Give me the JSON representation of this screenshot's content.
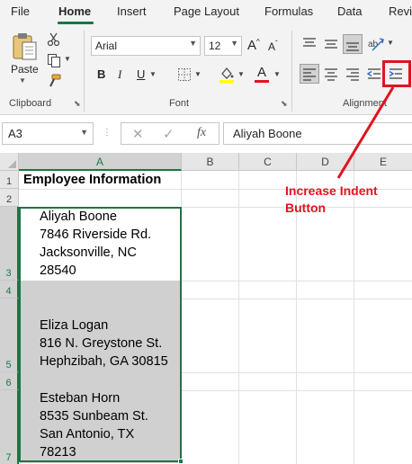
{
  "ribbon_tabs": [
    "File",
    "Home",
    "Insert",
    "Page Layout",
    "Formulas",
    "Data",
    "Revi"
  ],
  "active_tab": "Home",
  "clipboard": {
    "paste_label": "Paste",
    "group_label": "Clipboard",
    "icons": [
      "paste-icon",
      "cut-icon",
      "copy-icon",
      "format-painter-icon"
    ]
  },
  "font": {
    "font_name": "Arial",
    "font_size": "12",
    "group_label": "Font",
    "bold_label": "B",
    "italic_label": "I",
    "underline_label": "U",
    "font_color_label": "A",
    "grow_label": "A",
    "shrink_label": "A"
  },
  "alignment": {
    "group_label": "Alignment",
    "icons": [
      "align-top-icon",
      "align-middle-icon",
      "align-bottom-icon",
      "orientation-icon",
      "align-left-icon",
      "center-icon",
      "align-right-icon",
      "decrease-indent-icon",
      "increase-indent-icon"
    ]
  },
  "formula_bar": {
    "name_box": "A3",
    "cancel_symbol": "✕",
    "enter_symbol": "✓",
    "fx_label": "fx",
    "content": "Aliyah Boone"
  },
  "grid": {
    "columns": [
      "A",
      "B",
      "C",
      "D",
      "E"
    ],
    "selected_column": "A",
    "rows": [
      "1",
      "2",
      "3",
      "4",
      "5",
      "6",
      "7"
    ],
    "cells": {
      "A1": "Employee Information",
      "A3": [
        "Aliyah Boone",
        "7846 Riverside Rd.",
        "Jacksonville, NC",
        "28540"
      ],
      "A5": [
        "Eliza Logan",
        "816 N. Greystone St.",
        "Hephzibah, GA 30815"
      ],
      "A7": [
        "Esteban Horn",
        "8535 Sunbeam St.",
        "San Antonio, TX",
        "78213"
      ]
    }
  },
  "annotation": {
    "line1": "Increase Indent",
    "line2": "Button"
  },
  "colors": {
    "accent_green": "#107c41",
    "annotation_red": "#e0141e",
    "selection_fill": "#d0d0d0"
  }
}
